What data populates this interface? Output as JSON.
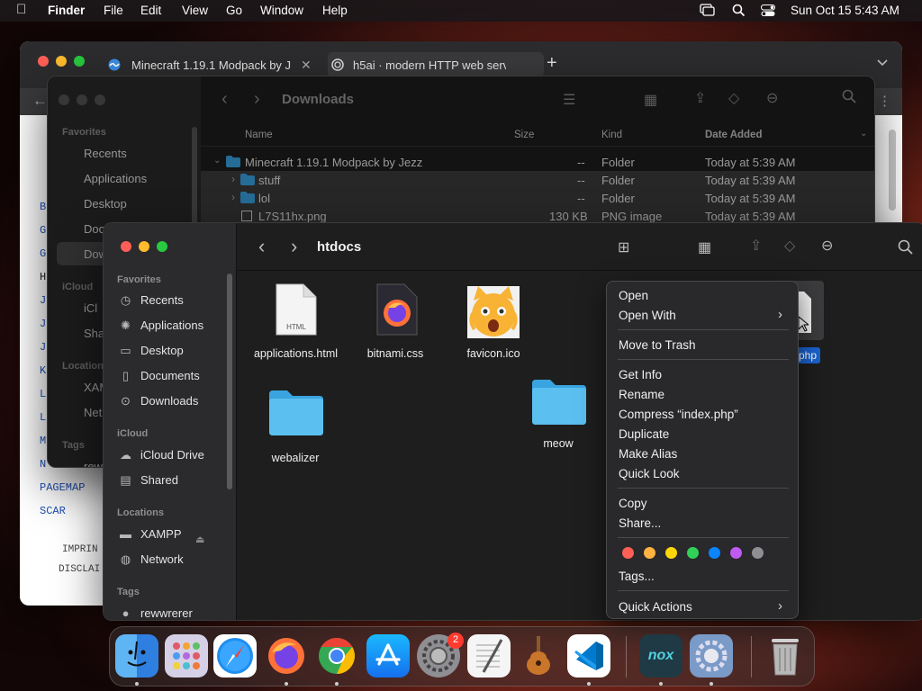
{
  "menubar": {
    "app": "Finder",
    "items": [
      "File",
      "Edit",
      "View",
      "Go",
      "Window",
      "Help"
    ],
    "clock": "Sun Oct 15  5:43 AM"
  },
  "browser": {
    "tabs": [
      {
        "label": "Minecraft 1.19.1 Modpack by J",
        "icon": "wave-icon"
      },
      {
        "label": "h5ai · modern HTTP web serv",
        "icon": "h5ai-icon"
      }
    ],
    "links": [
      "B",
      "G",
      "G",
      "H",
      "J",
      "J",
      "J",
      "K",
      "L",
      "L",
      "M",
      "N",
      "PAGEMAP",
      "SCAR"
    ],
    "footer": [
      "IMPRIN",
      "DISCLAI"
    ]
  },
  "finder_back": {
    "title": "Downloads",
    "sidebar": {
      "favorites_header": "Favorites",
      "favorites": [
        "Recents",
        "Applications",
        "Desktop",
        "Doc",
        "Dow"
      ],
      "icloud_header": "iCloud",
      "icloud": [
        "iCl",
        "Sha"
      ],
      "locations_header": "Location",
      "locations": [
        "XAM",
        "Net"
      ],
      "tags_header": "Tags",
      "tags": [
        "rew"
      ]
    },
    "columns": {
      "name": "Name",
      "size": "Size",
      "kind": "Kind",
      "date": "Date Added"
    },
    "rows": [
      {
        "name": "Minecraft 1.19.1 Modpack by Jezz",
        "size": "--",
        "kind": "Folder",
        "date": "Today at 5:39 AM"
      },
      {
        "name": "stuff",
        "size": "--",
        "kind": "Folder",
        "date": "Today at 5:39 AM"
      },
      {
        "name": "lol",
        "size": "--",
        "kind": "Folder",
        "date": "Today at 5:39 AM"
      },
      {
        "name": "L7S11hx.png",
        "size": "130 KB",
        "kind": "PNG image",
        "date": "Today at 5:39 AM"
      }
    ]
  },
  "finder_front": {
    "title": "htdocs",
    "sidebar": {
      "favorites_header": "Favorites",
      "favorites": [
        "Recents",
        "Applications",
        "Desktop",
        "Documents",
        "Downloads"
      ],
      "icloud_header": "iCloud",
      "icloud": [
        "iCloud Drive",
        "Shared"
      ],
      "locations_header": "Locations",
      "locations": [
        "XAMPP",
        "Network"
      ],
      "tags_header": "Tags",
      "tags": [
        "rewwrerer"
      ]
    },
    "files": [
      {
        "name": "applications.html",
        "type": "html",
        "badge": "HTML"
      },
      {
        "name": "bitnami.css",
        "type": "css"
      },
      {
        "name": "favicon.ico",
        "type": "ico"
      },
      {
        "name": "webalizer",
        "type": "folder"
      },
      {
        "name": "meow",
        "type": "folder"
      },
      {
        "name": "php",
        "type": "php-selected"
      }
    ]
  },
  "context_menu": {
    "group1": [
      "Open",
      "Open With"
    ],
    "group2": [
      "Move to Trash"
    ],
    "group3": [
      "Get Info",
      "Rename",
      "Compress “index.php”",
      "Duplicate",
      "Make Alias",
      "Quick Look"
    ],
    "group4": [
      "Copy",
      "Share..."
    ],
    "tag_colors": [
      "#ff5f57",
      "#ffb340",
      "#ffd60a",
      "#30d158",
      "#0a84ff",
      "#bf5af2",
      "#8e8e93"
    ],
    "tags_label": "Tags...",
    "quick_actions": "Quick Actions"
  },
  "dock": {
    "items": [
      "finder",
      "launchpad",
      "safari",
      "firefox",
      "chrome",
      "app-store",
      "system-preferences",
      "textedit",
      "garageband",
      "vscode",
      "nox",
      "xampp-manager",
      "trash"
    ],
    "badge": "2"
  }
}
